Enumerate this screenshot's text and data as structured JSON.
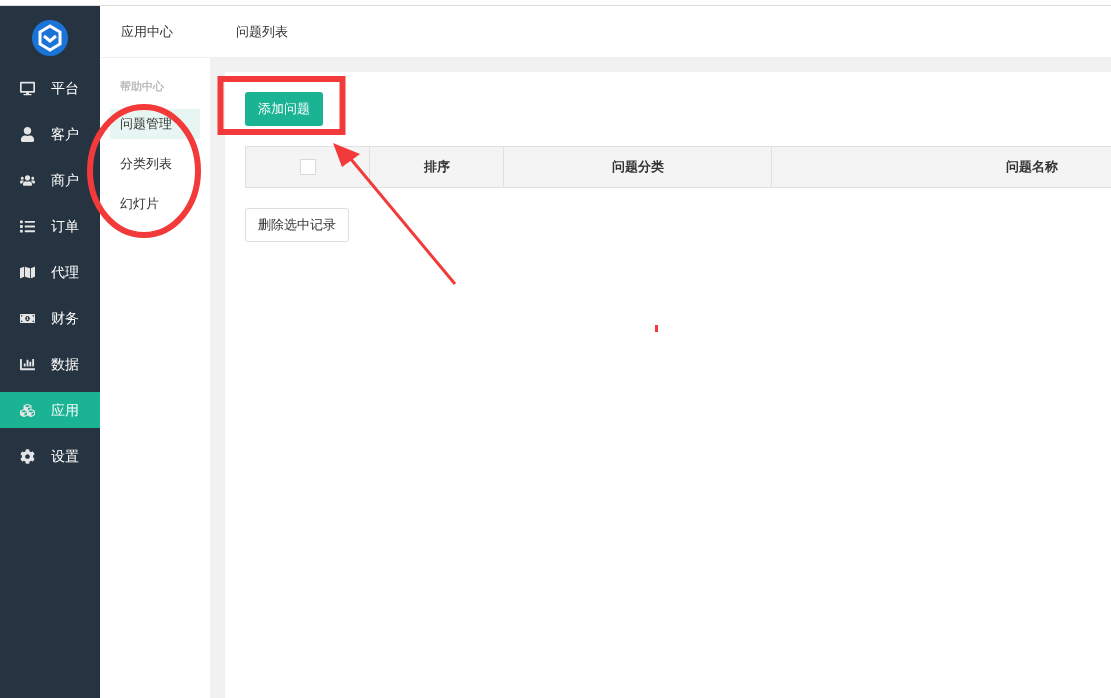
{
  "app_nav": [
    {
      "label": "平台",
      "selected": false
    },
    {
      "label": "客户",
      "selected": false
    },
    {
      "label": "商户",
      "selected": false
    },
    {
      "label": "订单",
      "selected": false
    },
    {
      "label": "代理",
      "selected": false
    },
    {
      "label": "财务",
      "selected": false
    },
    {
      "label": "数据",
      "selected": false
    },
    {
      "label": "应用",
      "selected": true
    },
    {
      "label": "设置",
      "selected": false
    }
  ],
  "sub_nav": {
    "header": "应用中心",
    "section_title": "帮助中心",
    "items": [
      {
        "label": "问题管理",
        "selected": true
      },
      {
        "label": "分类列表",
        "selected": false
      },
      {
        "label": "幻灯片",
        "selected": false
      }
    ]
  },
  "breadcrumb": "问题列表",
  "add_button": "添加问题",
  "table": {
    "select_all_checked": false,
    "columns": [
      "排序",
      "问题分类",
      "问题名称"
    ]
  },
  "delete_button": "删除选中记录"
}
